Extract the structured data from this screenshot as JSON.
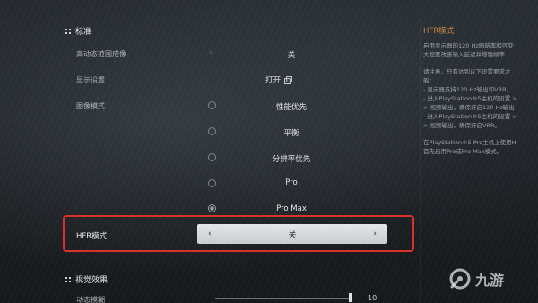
{
  "section_standard": {
    "title": "标准"
  },
  "rows": {
    "hdr": {
      "label": "高动态范围成像",
      "value": "关"
    },
    "display": {
      "label": "显示设置",
      "value": "打开"
    },
    "image_mode": {
      "label": "图像模式"
    }
  },
  "image_modes": [
    {
      "label": "性能优先",
      "selected": false
    },
    {
      "label": "平衡",
      "selected": false
    },
    {
      "label": "分辨率优先",
      "selected": false
    },
    {
      "label": "Pro",
      "selected": false
    },
    {
      "label": "Pro Max",
      "selected": true
    }
  ],
  "hfr": {
    "label": "HFR模式",
    "value": "关",
    "prev": "‹",
    "next": "›"
  },
  "section_visual": {
    "title": "视觉效果"
  },
  "motion_blur": {
    "label": "动态模糊",
    "value": "10",
    "level_fraction": 0.99
  },
  "help_panel": {
    "title": "HFR模式",
    "lines_a": [
      "启用显示器的120 Hz刷新率和可变",
      "大程度改善输入延迟并增强帧率"
    ],
    "lines_b": [
      "请注意，只有达到以下设置要求才",
      "能：",
      "- 显示器支持120 Hz输出和VRR。",
      "- 进入PlayStation®5主机的设置 >",
      "> 视频输出，确保开启120 Hz输出",
      "- 进入PlayStation®5主机的设置 >",
      "> 视频输出，确保开启VRR。"
    ],
    "lines_c": [
      "在PlayStation®5 Pro主机上使用H",
      "首先启用Pro或Pro Max模式。"
    ]
  },
  "watermark": {
    "text": "九游"
  },
  "colors": {
    "accent_orange": "#c98b45",
    "highlight_red": "#d9322b",
    "hfr_box": "#dcdfe2"
  }
}
